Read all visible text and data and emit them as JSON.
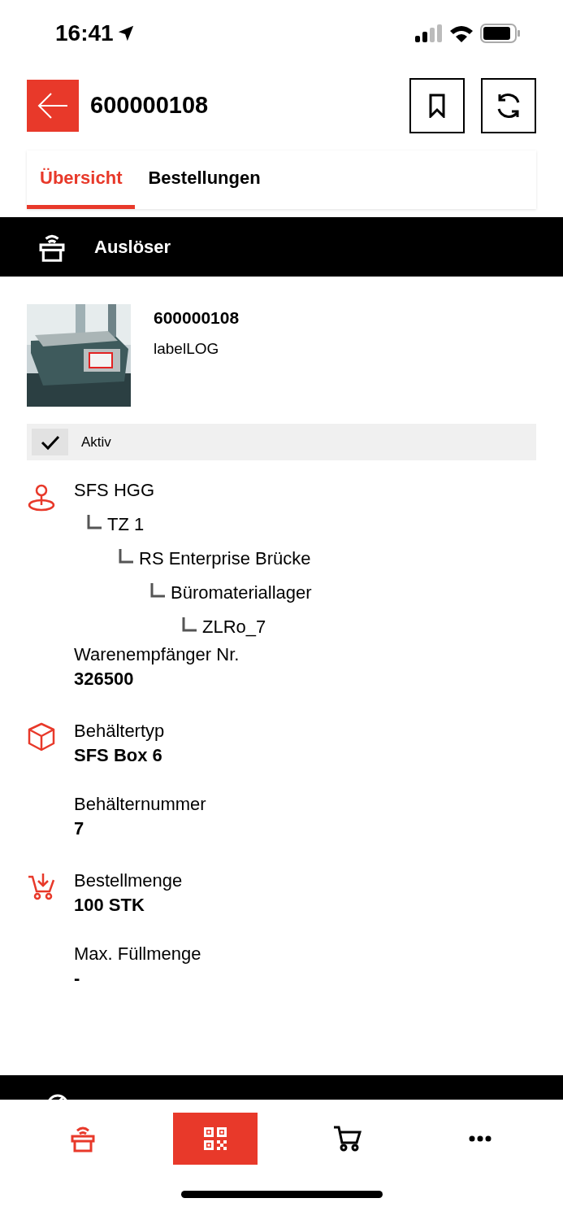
{
  "status_bar": {
    "time": "16:41"
  },
  "header": {
    "title": "600000108"
  },
  "tabs": [
    {
      "label": "Übersicht",
      "selected": true
    },
    {
      "label": "Bestellungen",
      "selected": false
    }
  ],
  "section": {
    "title": "Auslöser"
  },
  "product": {
    "number": "600000108",
    "name": "labelLOG"
  },
  "status": {
    "label": "Aktiv",
    "checked": true
  },
  "location": {
    "name": "SFS HGG",
    "children": [
      {
        "name": "TZ 1",
        "children": [
          {
            "name": "RS Enterprise Brücke",
            "children": [
              {
                "name": "Büromateriallager",
                "children": [
                  {
                    "name": "ZLRo_7"
                  }
                ]
              }
            ]
          }
        ]
      }
    ]
  },
  "groups": [
    {
      "kind": "location",
      "fields": [
        {
          "label": "Warenempfänger Nr.",
          "value": "326500"
        }
      ]
    },
    {
      "kind": "container",
      "fields": [
        {
          "label": "Behältertyp",
          "value": "SFS Box 6"
        },
        {
          "label": "Behälternummer",
          "value": "7"
        }
      ]
    },
    {
      "kind": "order",
      "fields": [
        {
          "label": "Bestellmenge",
          "value": "100 STK"
        },
        {
          "label": "Max. Füllmenge",
          "value": "-"
        }
      ]
    }
  ],
  "bottom_nav": [
    {
      "kind": "trigger",
      "active": true,
      "selected": false
    },
    {
      "kind": "qr",
      "active": false,
      "selected": true
    },
    {
      "kind": "cart",
      "active": false,
      "selected": false
    },
    {
      "kind": "more",
      "active": false,
      "selected": false
    }
  ]
}
